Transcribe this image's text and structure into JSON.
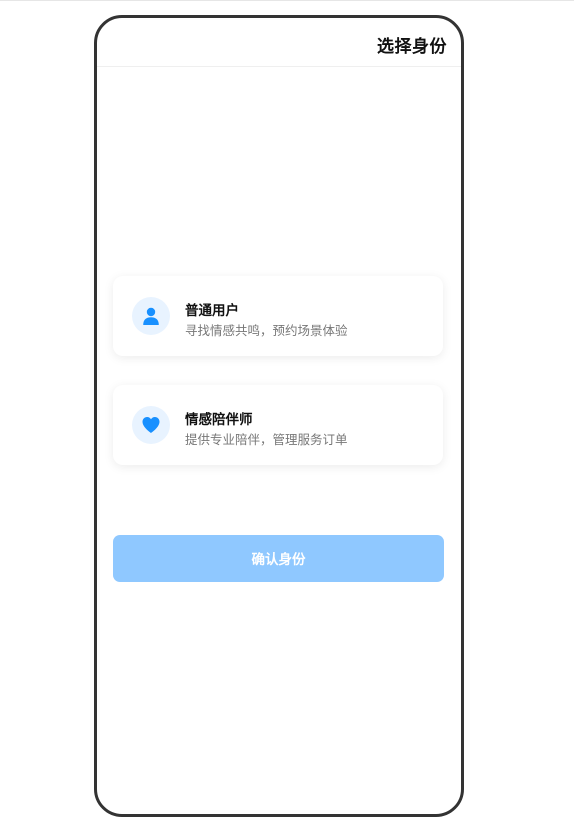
{
  "header": {
    "title": "选择身份"
  },
  "roles": [
    {
      "icon": "user-icon",
      "title": "普通用户",
      "description": "寻找情感共鸣，预约场景体验"
    },
    {
      "icon": "heart-icon",
      "title": "情感陪伴师",
      "description": "提供专业陪伴，管理服务订单"
    }
  ],
  "confirm": {
    "label": "确认身份"
  },
  "colors": {
    "accent": "#1890ff",
    "accent_light": "#e8f3ff",
    "button_disabled": "#8fc8ff",
    "frame": "#333333"
  }
}
